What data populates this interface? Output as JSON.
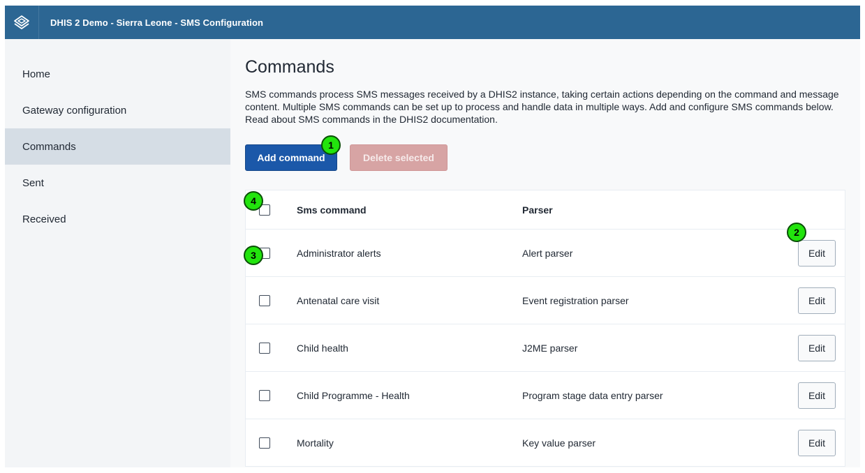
{
  "header": {
    "title": "DHIS 2 Demo - Sierra Leone - SMS Configuration",
    "logo_icon": "dhis2-logo-icon"
  },
  "sidebar": {
    "items": [
      {
        "label": "Home"
      },
      {
        "label": "Gateway configuration"
      },
      {
        "label": "Commands",
        "active": true
      },
      {
        "label": "Sent"
      },
      {
        "label": "Received"
      }
    ]
  },
  "main": {
    "title": "Commands",
    "description": "SMS commands process SMS messages received by a DHIS2 instance, taking certain actions depending on the command and message content. Multiple SMS commands can be set up to process and handle data in multiple ways. Add and configure SMS commands below. Read about SMS commands in the DHIS2 documentation.",
    "add_button": "Add command",
    "delete_button": "Delete selected"
  },
  "table": {
    "headers": {
      "command": "Sms command",
      "parser": "Parser"
    },
    "edit_label": "Edit",
    "rows": [
      {
        "command": "Administrator alerts",
        "parser": "Alert parser"
      },
      {
        "command": "Antenatal care visit",
        "parser": "Event registration parser"
      },
      {
        "command": "Child health",
        "parser": "J2ME parser"
      },
      {
        "command": "Child Programme - Health",
        "parser": "Program stage data entry parser"
      },
      {
        "command": "Mortality",
        "parser": "Key value parser"
      }
    ]
  },
  "markers": [
    "1",
    "2",
    "3",
    "4"
  ],
  "colors": {
    "topbar": "#2c6693",
    "primary": "#1b58a9",
    "destructive_disabled": "#d7a4a4",
    "marker": "#22e40d"
  }
}
